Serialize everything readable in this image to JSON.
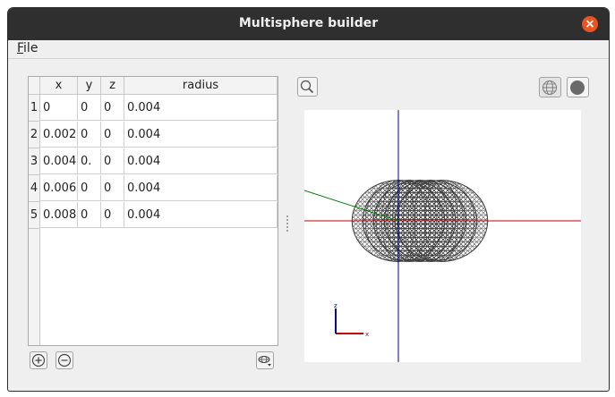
{
  "window": {
    "title": "Multisphere builder",
    "close_symbol": "×"
  },
  "menu": {
    "file_mnemonic": "F",
    "file_rest": "ile"
  },
  "table": {
    "columns": [
      "x",
      "y",
      "z",
      "radius"
    ],
    "rows": [
      {
        "index": "1",
        "x": "0",
        "y": "0",
        "z": "0",
        "radius": "0.004"
      },
      {
        "index": "2",
        "x": "0.002",
        "y": "0",
        "z": "0",
        "radius": "0.004"
      },
      {
        "index": "3",
        "x": "0.004",
        "y": "0.",
        "z": "0",
        "radius": "0.004"
      },
      {
        "index": "4",
        "x": "0.006",
        "y": "0",
        "z": "0",
        "radius": "0.004"
      },
      {
        "index": "5",
        "x": "0.008",
        "y": "0",
        "z": "0",
        "radius": "0.004"
      }
    ]
  },
  "toolbar": {
    "add_icon": "plus-circle-icon",
    "remove_icon": "minus-circle-icon",
    "import_icon": "mesh-dropdown-icon",
    "zoom_icon": "magnifier-icon",
    "wireframe_icon": "wireframe-sphere-icon",
    "solid_icon": "solid-sphere-icon"
  },
  "viewport": {
    "axis_colors": {
      "x": "#c00000",
      "y": "#008000",
      "z": "#00008b"
    },
    "sphere_color": "#3c3c3c",
    "triad_labels": {
      "x": "x",
      "z": "z"
    }
  }
}
